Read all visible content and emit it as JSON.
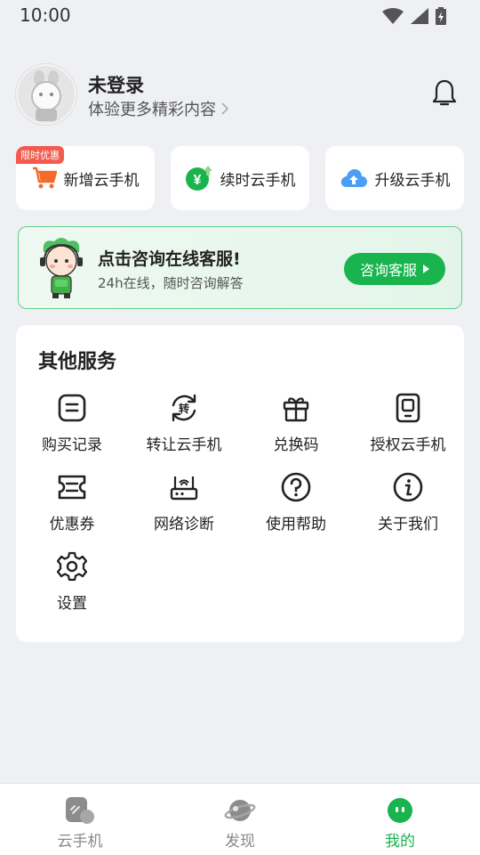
{
  "status_bar": {
    "time": "10:00"
  },
  "profile": {
    "name": "未登录",
    "subtitle": "体验更多精彩内容"
  },
  "quick_actions": {
    "badge": "限时优惠",
    "items": [
      {
        "label": "新增云手机",
        "icon": "cart-icon"
      },
      {
        "label": "续时云手机",
        "icon": "renew-yuan-icon"
      },
      {
        "label": "升级云手机",
        "icon": "cloud-upload-icon"
      }
    ]
  },
  "support": {
    "title": "点击咨询在线客服!",
    "desc": "24h在线，随时咨询解答",
    "button": "咨询客服"
  },
  "services": {
    "title": "其他服务",
    "items": [
      {
        "label": "购买记录",
        "icon": "purchase-record-icon"
      },
      {
        "label": "转让云手机",
        "icon": "transfer-icon"
      },
      {
        "label": "兑换码",
        "icon": "gift-icon"
      },
      {
        "label": "授权云手机",
        "icon": "authorize-phone-icon"
      },
      {
        "label": "优惠券",
        "icon": "coupon-icon"
      },
      {
        "label": "网络诊断",
        "icon": "router-icon"
      },
      {
        "label": "使用帮助",
        "icon": "help-icon"
      },
      {
        "label": "关于我们",
        "icon": "info-icon"
      },
      {
        "label": "设置",
        "icon": "settings-icon"
      }
    ]
  },
  "tabbar": {
    "items": [
      {
        "label": "云手机",
        "icon": "cloud-phone-icon"
      },
      {
        "label": "发现",
        "icon": "planet-icon"
      },
      {
        "label": "我的",
        "icon": "profile-face-icon"
      }
    ],
    "active_index": 2
  },
  "colors": {
    "accent": "#19b44d",
    "badge": "#f35b4f",
    "cart": "#f26b2a",
    "cloud": "#4a9ff5"
  }
}
